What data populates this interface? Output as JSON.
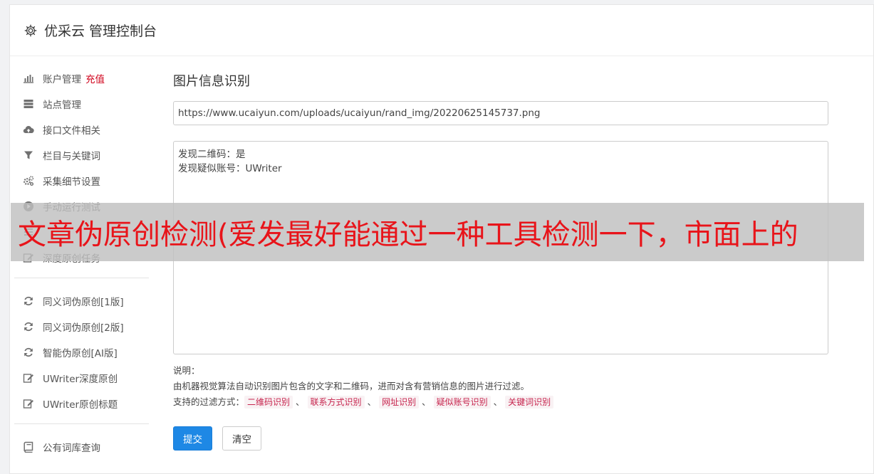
{
  "header": {
    "title": "优采云 管理控制台",
    "icon": "gear-icon"
  },
  "sidebar": {
    "groups": [
      [
        {
          "label": "账户管理",
          "sub": "充值",
          "icon": "bar-chart-icon"
        },
        {
          "label": "站点管理",
          "icon": "server-icon"
        },
        {
          "label": "接口文件相关",
          "icon": "cloud-upload-icon"
        },
        {
          "label": "栏目与关键词",
          "icon": "filter-icon"
        },
        {
          "label": "采集细节设置",
          "icon": "gears-icon"
        },
        {
          "label": "手动运行测试",
          "icon": "play-icon"
        },
        {
          "label": "",
          "icon": "list-icon"
        },
        {
          "label": "深度原创任务",
          "icon": "edit-icon"
        }
      ],
      [
        {
          "label": "同义词伪原创[1版]",
          "icon": "refresh-icon"
        },
        {
          "label": "同义词伪原创[2版]",
          "icon": "refresh-icon"
        },
        {
          "label": "智能伪原创[AI版]",
          "icon": "refresh-icon"
        },
        {
          "label": "UWriter深度原创",
          "icon": "edit-icon"
        },
        {
          "label": "UWriter原创标题",
          "icon": "edit-icon"
        }
      ],
      [
        {
          "label": "公有词库查询",
          "icon": "book-icon"
        }
      ]
    ]
  },
  "main": {
    "title": "图片信息识别",
    "url_value": "https://www.ucaiyun.com/uploads/ucaiyun/rand_img/20220625145737.png",
    "result_lines": [
      "发现二维码：是",
      "发现疑似账号：UWriter"
    ],
    "notes": {
      "label": "说明：",
      "description": "由机器视觉算法自动识别图片包含的文字和二维码，进而对含有营销信息的图片进行过滤。",
      "support_label": "支持的过滤方式：",
      "tags": [
        "二维码识别",
        "联系方式识别",
        "网址识别",
        "疑似账号识别",
        "关键词识别"
      ],
      "separator": "、"
    },
    "buttons": {
      "submit": "提交",
      "clear": "清空"
    }
  },
  "banner": {
    "text": "文章伪原创检测(爱发最好能通过一种工具检测一下，市面上的"
  },
  "colors": {
    "primary": "#1e88e5",
    "recharge": "#d0021b",
    "tag_text": "#c7254e",
    "tag_bg": "#f9f2f4",
    "banner_text": "#e8141a"
  }
}
